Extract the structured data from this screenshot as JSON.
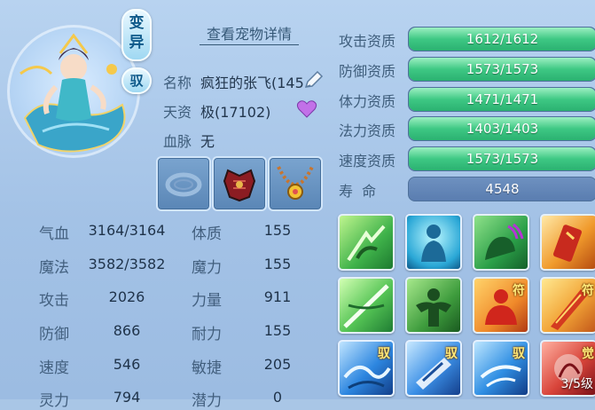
{
  "pet": {
    "variant_badge": "变异",
    "mount_badge": "驭",
    "details_link": "查看宠物详情",
    "name_label": "名称",
    "name_value": "疯狂的张飞(145)",
    "talent_label": "天资",
    "talent_value": "极(17102)",
    "bloodline_label": "血脉",
    "bloodline_value": "无"
  },
  "stats": [
    {
      "label": "气血",
      "value": "3164/3164"
    },
    {
      "label": "体质",
      "value": "155"
    },
    {
      "label": "魔法",
      "value": "3582/3582"
    },
    {
      "label": "魔力",
      "value": "155"
    },
    {
      "label": "攻击",
      "value": "2026"
    },
    {
      "label": "力量",
      "value": "911"
    },
    {
      "label": "防御",
      "value": "866"
    },
    {
      "label": "耐力",
      "value": "155"
    },
    {
      "label": "速度",
      "value": "546"
    },
    {
      "label": "敏捷",
      "value": "205"
    },
    {
      "label": "灵力",
      "value": "794"
    },
    {
      "label": "潜力",
      "value": "0"
    }
  ],
  "aptitudes": [
    {
      "label": "攻击资质",
      "value": "1612/1612",
      "fill": 1.0
    },
    {
      "label": "防御资质",
      "value": "1573/1573",
      "fill": 1.0
    },
    {
      "label": "体力资质",
      "value": "1471/1471",
      "fill": 1.0
    },
    {
      "label": "法力资质",
      "value": "1403/1403",
      "fill": 1.0
    },
    {
      "label": "速度资质",
      "value": "1573/1573",
      "fill": 1.0
    }
  ],
  "lifespan": {
    "label": "寿  命",
    "value": "4548"
  },
  "skills": {
    "badges": [
      "符",
      "符",
      "驭",
      "驭",
      "驭",
      "觉"
    ],
    "awaken_count": "3/5级"
  },
  "colors": {
    "bar_fill": "#3ec884",
    "panel_bg": "#a9c6e6"
  }
}
